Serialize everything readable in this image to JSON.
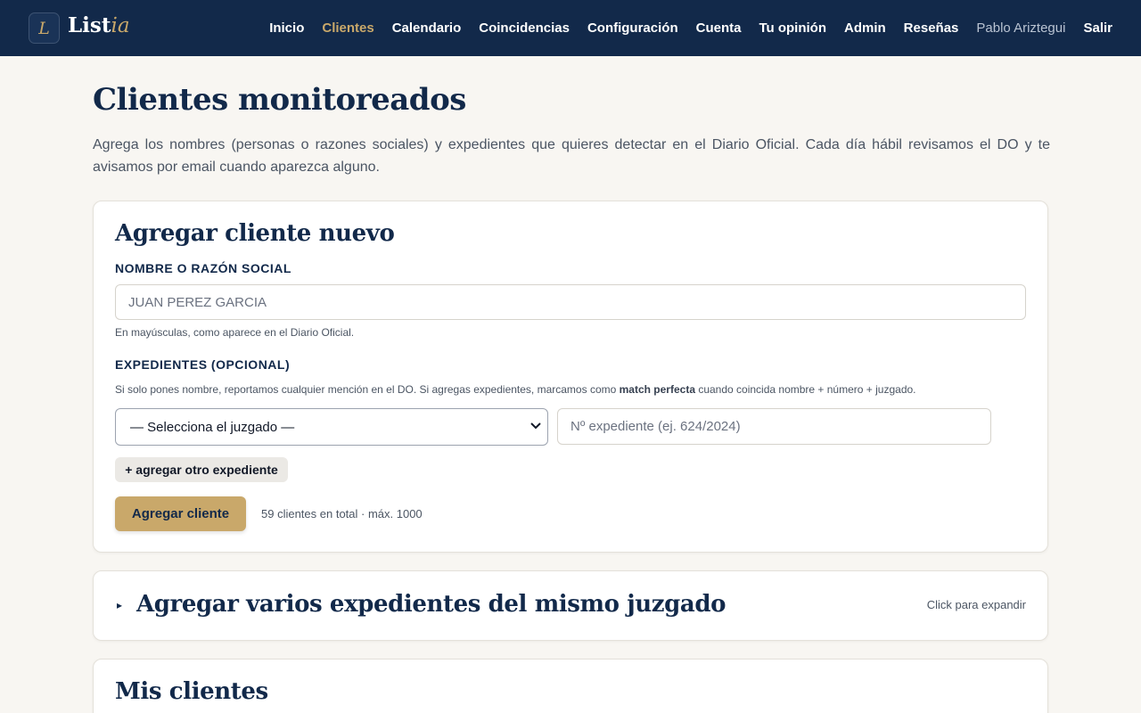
{
  "nav": {
    "logo_mark": "L",
    "logo_main": "List",
    "logo_accent": "ia",
    "links": [
      "Inicio",
      "Clientes",
      "Calendario",
      "Coincidencias",
      "Configuración",
      "Cuenta",
      "Tu opinión",
      "Admin",
      "Reseñas"
    ],
    "active": "Clientes",
    "user": "Pablo Ariztegui",
    "logout": "Salir"
  },
  "page": {
    "title": "Clientes monitoreados",
    "description": "Agrega los nombres (personas o razones sociales) y expedientes que quieres detectar en el Diario Oficial. Cada día hábil revisamos el DO y te avisamos por email cuando aparezca alguno."
  },
  "add_form": {
    "title": "Agregar cliente nuevo",
    "name_label": "NOMBRE O RAZÓN SOCIAL",
    "name_placeholder": "JUAN PEREZ GARCIA",
    "name_hint": "En mayúsculas, como aparece en el Diario Oficial.",
    "exp_label": "EXPEDIENTES (OPCIONAL)",
    "exp_hint_before": "Si solo pones nombre, reportamos cualquier mención en el DO. Si agregas expedientes, marcamos como ",
    "exp_hint_bold": "match perfecta",
    "exp_hint_after": " cuando coincida nombre + número + juzgado.",
    "court_select": "— Selecciona el juzgado —",
    "exp_placeholder": "Nº expediente (ej. 624/2024)",
    "add_exp_button": "+ agregar otro expediente",
    "submit_button": "Agregar cliente",
    "count_text": "59 clientes en total · máx. 1000"
  },
  "bulk": {
    "arrow": "▸",
    "title": "Agregar varios expedientes del mismo juzgado",
    "hint": "Click para expandir"
  },
  "list": {
    "title": "Mis clientes"
  },
  "colors": {
    "navy": "#12294a",
    "gold": "#c9a86a",
    "background": "#f8f6f2"
  }
}
